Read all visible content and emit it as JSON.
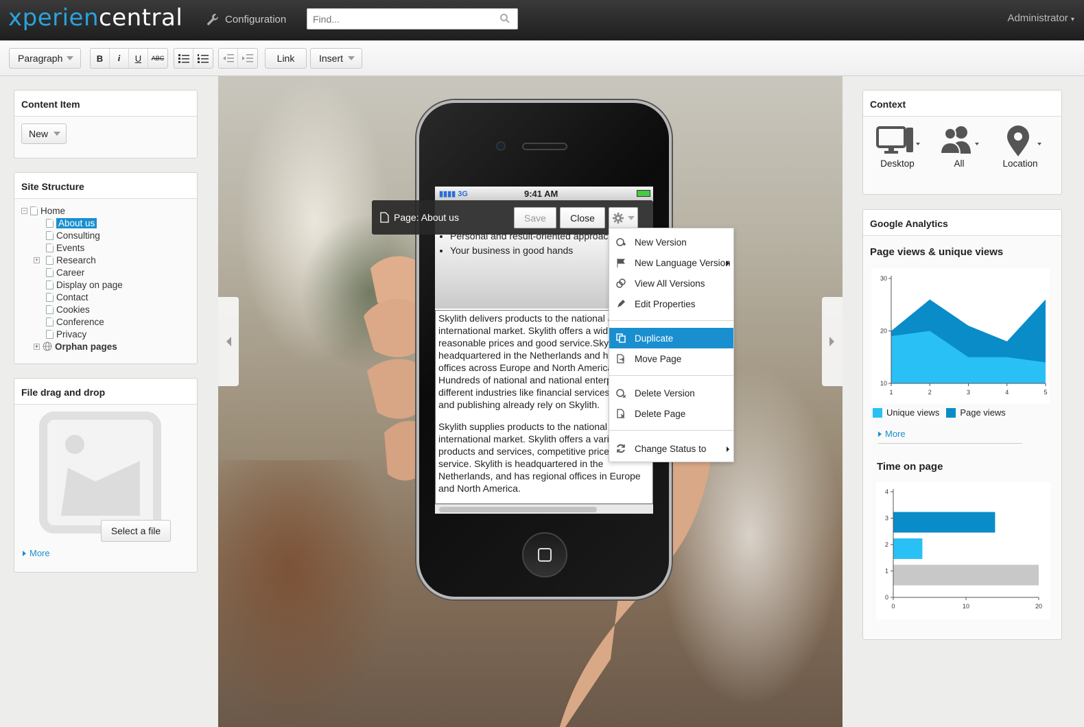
{
  "header": {
    "logo_a": "xperien",
    "logo_b": "central",
    "config_label": "Configuration",
    "search_placeholder": "Find...",
    "user": "Administrator"
  },
  "toolbar": {
    "paragraph": "Paragraph",
    "bold": "B",
    "italic": "i",
    "underline": "U",
    "strike": "ABC",
    "link": "Link",
    "insert": "Insert"
  },
  "content_item": {
    "title": "Content Item",
    "new_label": "New"
  },
  "site_structure": {
    "title": "Site Structure",
    "items": [
      {
        "label": "Home",
        "level": 0,
        "expand": "minus"
      },
      {
        "label": "About us",
        "level": 1,
        "selected": true
      },
      {
        "label": "Consulting",
        "level": 1
      },
      {
        "label": "Events",
        "level": 1
      },
      {
        "label": "Research",
        "level": 1,
        "expand": "plus"
      },
      {
        "label": "Career",
        "level": 1
      },
      {
        "label": "Display on page",
        "level": 1
      },
      {
        "label": "Contact",
        "level": 1
      },
      {
        "label": "Cookies",
        "level": 1
      },
      {
        "label": "Conference",
        "level": 1
      },
      {
        "label": "Privacy",
        "level": 1
      },
      {
        "label": "Orphan pages",
        "level": 0,
        "expand": "plus",
        "globe": true
      }
    ]
  },
  "file_dd": {
    "title": "File drag and drop",
    "select_label": "Select a file",
    "more": "More"
  },
  "phone": {
    "network": "3G",
    "time": "9:41 AM",
    "bullets": [
      "Personal and result-oriented approach",
      "Your business in good hands"
    ],
    "paragraphs": [
      "Skylith delivers products to the national and international market. Skylith offers a wide range, reasonable prices and good service.Skylith is headquartered in the Netherlands and has regional offices across Europe and North America. Hundreds of national and national enterprises in different industries like financial services, media and publishing already rely on Skylith.",
      "Skylith supplies products to the national and international market. Skylith offers a varied range of products and services, competitive prices and good service. Skylith is headquartered in the Netherlands, and has regional offices in Europe and North America."
    ]
  },
  "pagebar": {
    "title": "Page: About us",
    "save": "Save",
    "close": "Close"
  },
  "menu": {
    "items": [
      {
        "label": "New Version",
        "icon": "new-version-icon"
      },
      {
        "label": "New Language Version",
        "icon": "flag-icon",
        "submenu": true
      },
      {
        "label": "View All Versions",
        "icon": "versions-icon"
      },
      {
        "label": "Edit Properties",
        "icon": "pencil-icon"
      },
      {
        "label": "Duplicate",
        "icon": "duplicate-icon",
        "active": true
      },
      {
        "label": "Move Page",
        "icon": "move-icon"
      },
      {
        "label": "Delete Version",
        "icon": "delete-version-icon"
      },
      {
        "label": "Delete Page",
        "icon": "delete-page-icon"
      },
      {
        "label": "Change Status to",
        "icon": "status-icon",
        "submenu": true
      }
    ]
  },
  "context": {
    "title": "Context",
    "items": [
      {
        "label": "Desktop",
        "icon": "desktop-icon"
      },
      {
        "label": "All",
        "icon": "users-icon"
      },
      {
        "label": "Location",
        "icon": "location-pin-icon"
      }
    ]
  },
  "analytics": {
    "title": "Google Analytics",
    "chart1_title": "Page views & unique views",
    "chart2_title": "Time on page",
    "more": "More",
    "legend_unique": "Unique views",
    "legend_page": "Page views"
  },
  "chart_data": [
    {
      "type": "area",
      "title": "Page views & unique views",
      "x": [
        1,
        2,
        3,
        4,
        5
      ],
      "ylim": [
        10,
        30
      ],
      "yticks": [
        10,
        20,
        30
      ],
      "series": [
        {
          "name": "Unique views",
          "values": [
            19,
            20,
            15,
            15,
            14
          ],
          "color": "#29c0f5"
        },
        {
          "name": "Page views",
          "values": [
            20,
            26,
            21,
            18,
            26
          ],
          "color": "#0a8cc9"
        }
      ]
    },
    {
      "type": "bar",
      "title": "Time on page",
      "orientation": "horizontal",
      "categories": [
        1,
        2,
        3
      ],
      "values": [
        20,
        4,
        14
      ],
      "colors": [
        "#c8c8c8",
        "#29c0f5",
        "#0a8cc9"
      ],
      "xlim": [
        0,
        20
      ],
      "xticks": [
        0,
        10,
        20
      ],
      "yticks": [
        0,
        1,
        2,
        3,
        4
      ]
    }
  ]
}
